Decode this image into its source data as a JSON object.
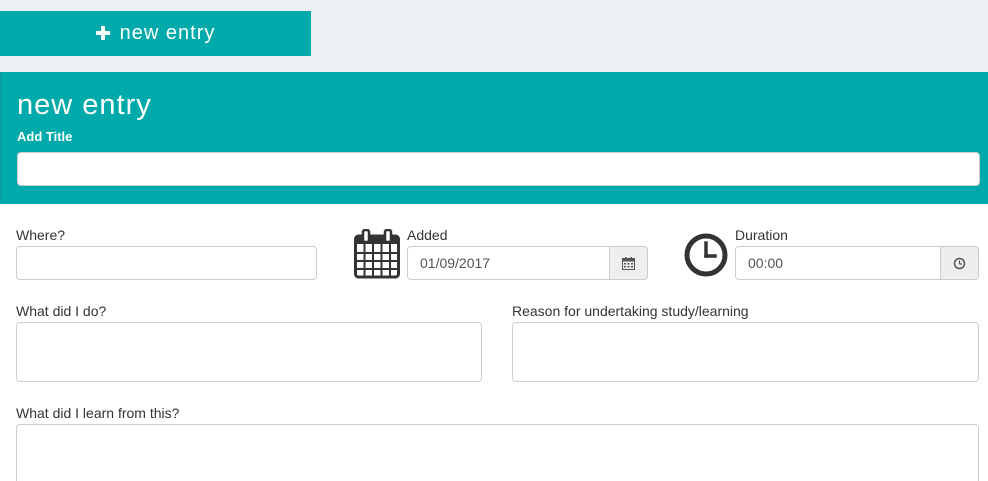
{
  "toolbar": {
    "new_entry_label": "new entry",
    "new_entry_icon": "plus-icon"
  },
  "panel": {
    "title": "new entry",
    "add_title_label": "Add Title",
    "add_title_value": ""
  },
  "form": {
    "where": {
      "label": "Where?",
      "value": ""
    },
    "added": {
      "label": "Added",
      "value": "01/09/2017",
      "icon": "calendar-icon",
      "addon_icon": "calendar-small-icon"
    },
    "duration": {
      "label": "Duration",
      "value": "00:00",
      "icon": "clock-icon",
      "addon_icon": "clock-small-icon"
    },
    "what_did_i_do": {
      "label": "What did I do?",
      "value": ""
    },
    "reason": {
      "label": "Reason for undertaking study/learning",
      "value": ""
    },
    "what_did_i_learn": {
      "label": "What did I learn from this?",
      "value": ""
    }
  },
  "colors": {
    "accent": "#00aaaa",
    "top_strip": "#ecf0f4",
    "icon_dark": "#333333",
    "addon_bg": "#eeeeee"
  }
}
